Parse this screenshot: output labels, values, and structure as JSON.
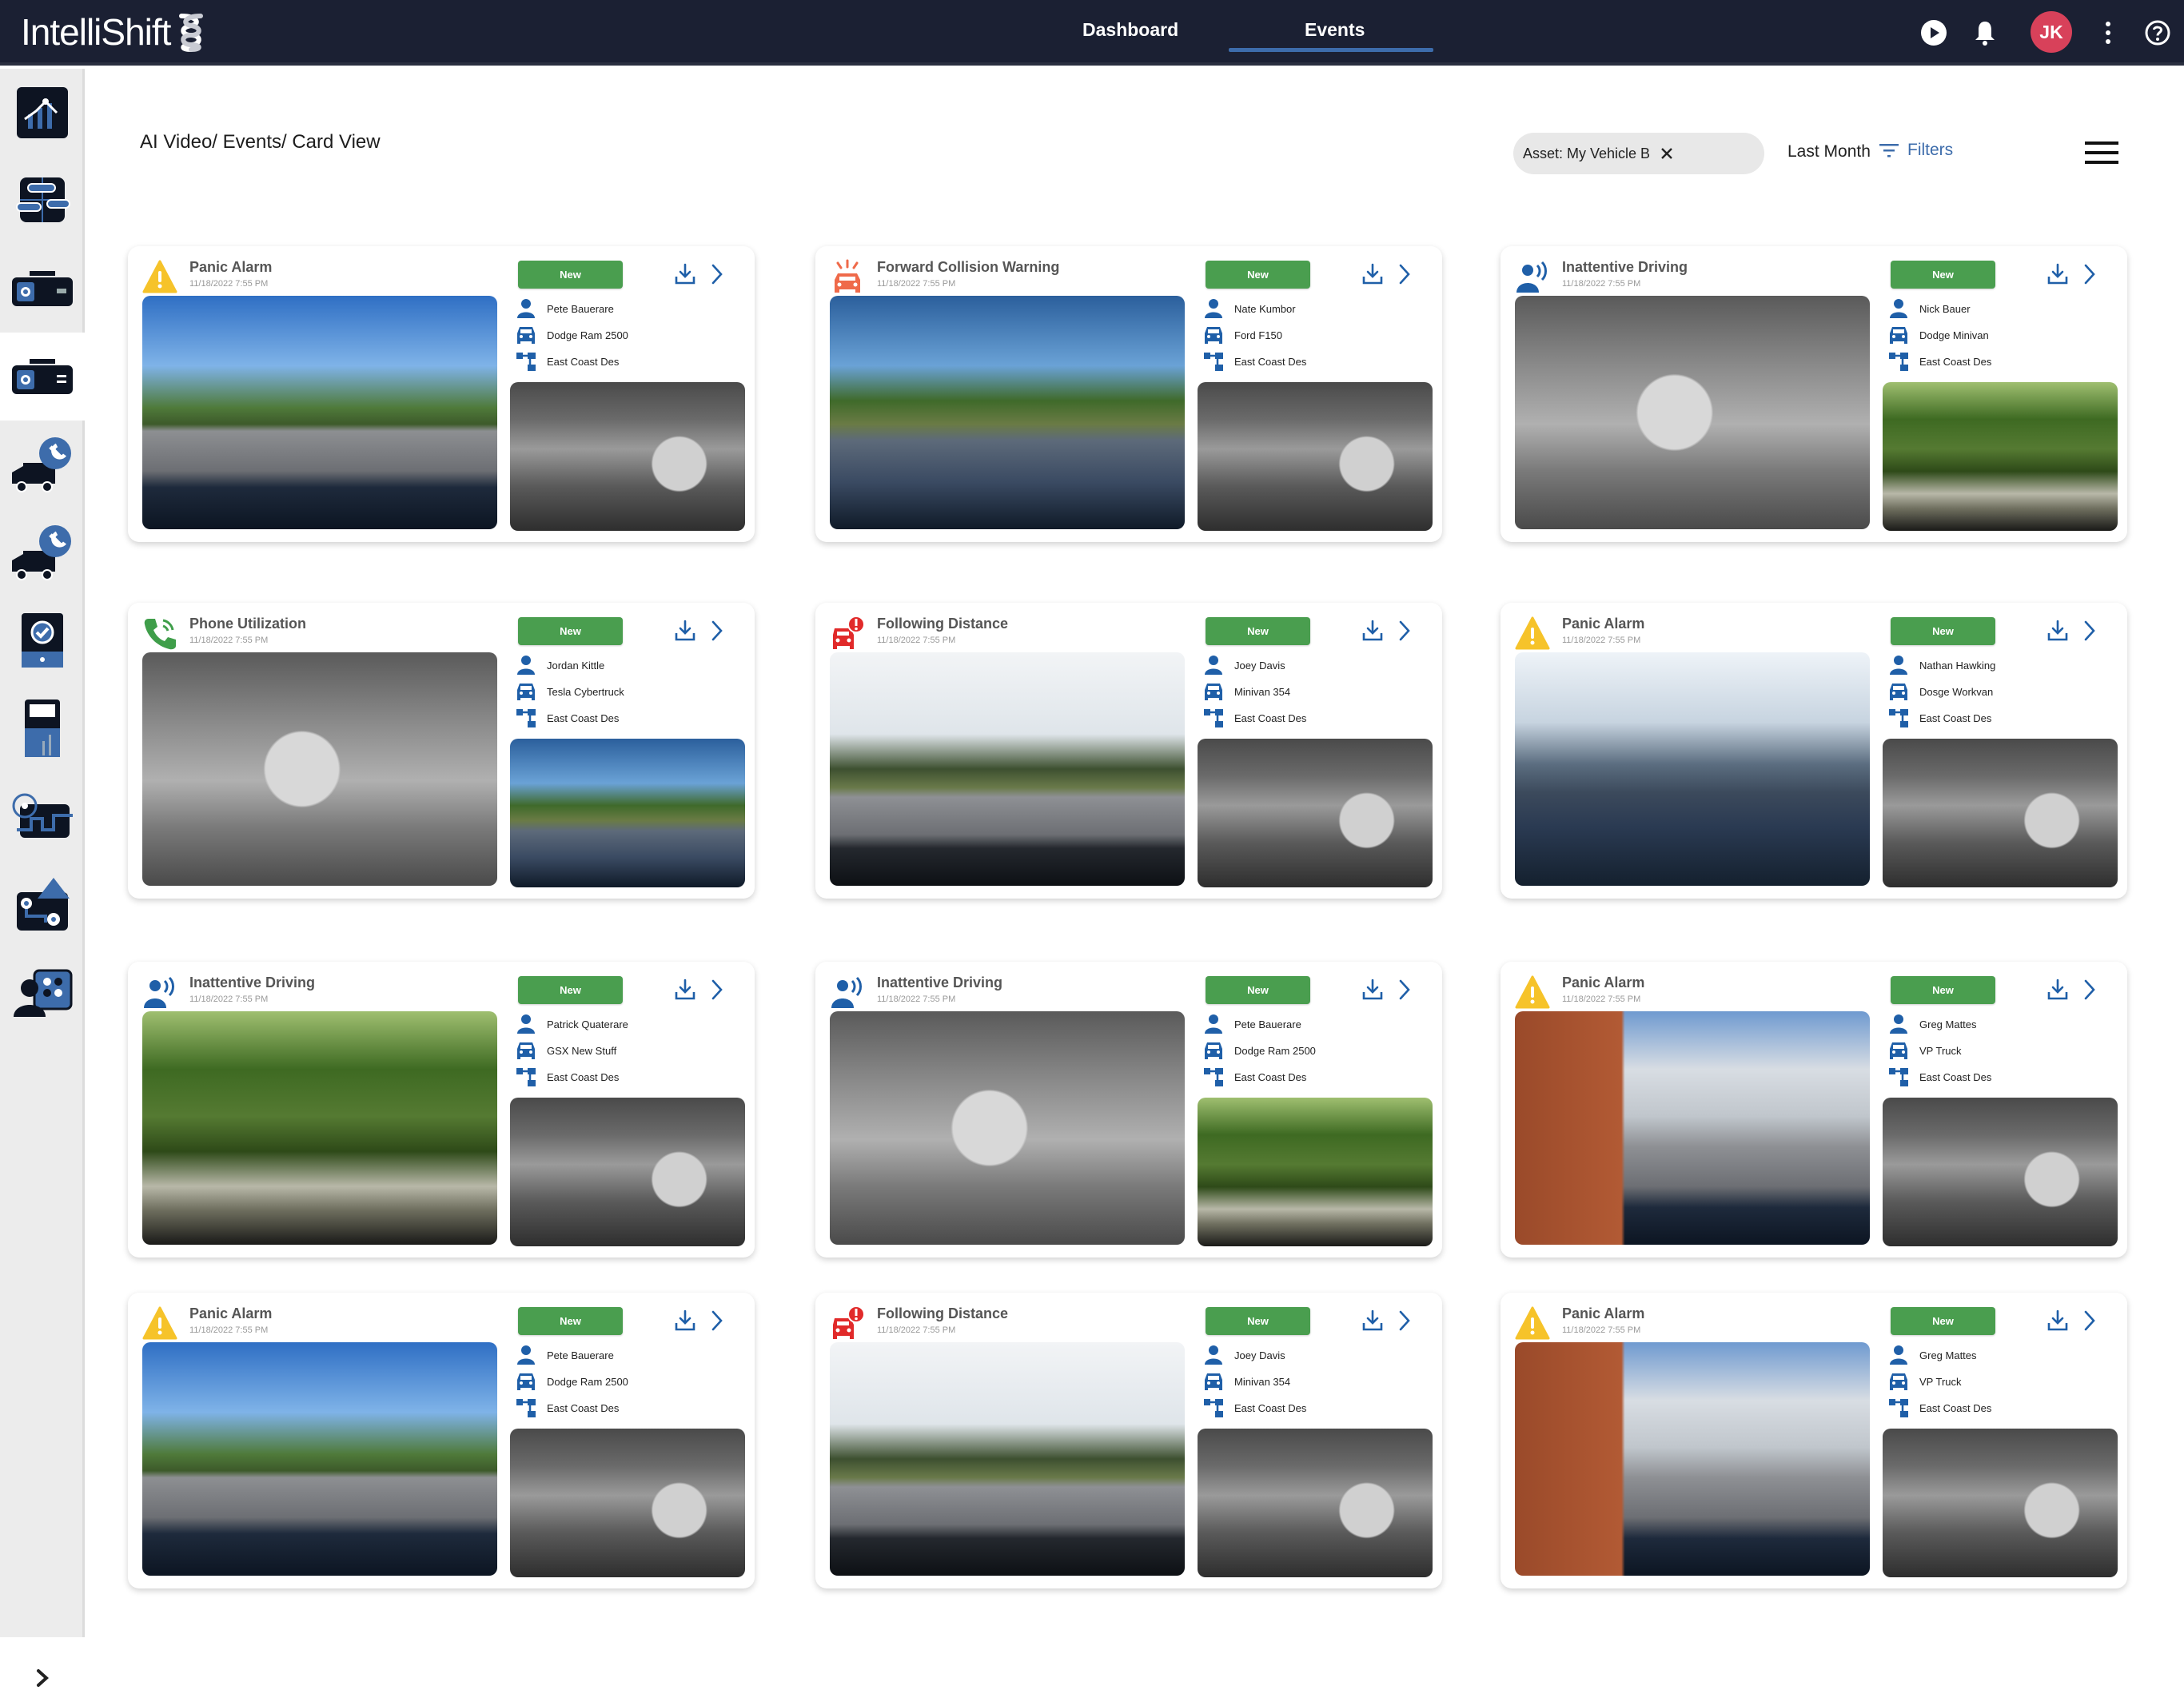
{
  "app": {
    "brand": "IntelliShift",
    "nav_tabs": [
      {
        "label": "Dashboard",
        "active": false
      },
      {
        "label": "Events",
        "active": true
      }
    ],
    "user_initials": "JK",
    "colors": {
      "header_bg": "#1b2033",
      "accent": "#3d6cab",
      "avatar": "#d8415a",
      "badge_new": "#4a9e4f",
      "icon_blue": "#1f5fa8",
      "warning_yellow": "#f6c32a",
      "collision_orange": "#ef6a4a",
      "distance_red": "#e12a2a",
      "phone_green": "#3f9e4a"
    }
  },
  "sidebar": {
    "items": [
      {
        "icon": "analytics-chart-icon",
        "active": false
      },
      {
        "icon": "dispatch-board-icon",
        "active": false
      },
      {
        "icon": "dashcam-icon",
        "active": false
      },
      {
        "icon": "dashcam-list-icon",
        "active": true
      },
      {
        "icon": "vehicle-maintenance-icon",
        "active": false
      },
      {
        "icon": "vehicle-service-icon",
        "active": false
      },
      {
        "icon": "inspection-tablet-icon",
        "active": false
      },
      {
        "icon": "fuel-reports-icon",
        "active": false
      },
      {
        "icon": "route-tracking-icon",
        "active": false
      },
      {
        "icon": "geofence-map-icon",
        "active": false
      },
      {
        "icon": "driver-management-icon",
        "active": false
      }
    ],
    "expand_icon": "chevron-right-icon"
  },
  "page": {
    "breadcrumb": "AI Video/ Events/ Card View",
    "filter_chip": "Asset: My Vehicle B",
    "period": "Last Month",
    "filters_label": "Filters"
  },
  "cards": [
    {
      "type": "panic",
      "title": "Panic Alarm",
      "time": "11/18/2022 7:55 PM",
      "status": "New",
      "driver": "Pete Bauerare",
      "vehicle": "Dodge Ram 2500",
      "group": "East Coast Des",
      "main": "scene-road",
      "side": "scene-cabin"
    },
    {
      "type": "collision",
      "title": "Forward Collision Warning",
      "time": "11/18/2022 7:55 PM",
      "status": "New",
      "driver": "Nate Kumbor",
      "vehicle": "Ford F150",
      "group": "East Coast Des",
      "main": "scene-road-green",
      "side": "scene-cabin"
    },
    {
      "type": "inattentive",
      "title": "Inattentive Driving",
      "time": "11/18/2022 7:55 PM",
      "status": "New",
      "driver": "Nick Bauer",
      "vehicle": "Dodge Minivan",
      "group": "East Coast Des",
      "main": "scene-cabin-light",
      "side": "scene-forest"
    },
    {
      "type": "phone",
      "title": "Phone Utilization",
      "time": "11/18/2022 7:55 PM",
      "status": "New",
      "driver": "Jordan Kittle",
      "vehicle": "Tesla Cybertruck",
      "group": "East Coast Des",
      "main": "scene-cabin-light",
      "side": "scene-road-green"
    },
    {
      "type": "distance",
      "title": "Following Distance",
      "time": "11/18/2022 7:55 PM",
      "status": "New",
      "driver": "Joey Davis",
      "vehicle": "Minivan 354",
      "group": "East Coast Des",
      "main": "scene-road-white",
      "side": "scene-cabin"
    },
    {
      "type": "panic",
      "title": "Panic Alarm",
      "time": "11/18/2022 7:55 PM",
      "status": "New",
      "driver": "Nathan Hawking",
      "vehicle": "Dosge Workvan",
      "group": "East Coast Des",
      "main": "scene-parking",
      "side": "scene-cabin"
    },
    {
      "type": "inattentive",
      "title": "Inattentive Driving",
      "time": "11/18/2022 7:55 PM",
      "status": "New",
      "driver": "Patrick Quaterare",
      "vehicle": "GSX New Stuff",
      "group": "East Coast Des",
      "main": "scene-forest",
      "side": "scene-cabin"
    },
    {
      "type": "inattentive",
      "title": "Inattentive Driving",
      "time": "11/18/2022 7:55 PM",
      "status": "New",
      "driver": "Pete Bauerare",
      "vehicle": "Dodge Ram 2500",
      "group": "East Coast Des",
      "main": "scene-cabin-light",
      "side": "scene-forest"
    },
    {
      "type": "panic",
      "title": "Panic Alarm",
      "time": "11/18/2022 7:55 PM",
      "status": "New",
      "driver": "Greg Mattes",
      "vehicle": "VP Truck",
      "group": "East Coast Des",
      "main": "scene-truck",
      "side": "scene-cabin"
    },
    {
      "type": "panic",
      "title": "Panic Alarm",
      "time": "11/18/2022 7:55 PM",
      "status": "New",
      "driver": "Pete Bauerare",
      "vehicle": "Dodge Ram 2500",
      "group": "East Coast Des",
      "main": "scene-road",
      "side": "scene-cabin"
    },
    {
      "type": "distance",
      "title": "Following Distance",
      "time": "11/18/2022 7:55 PM",
      "status": "New",
      "driver": "Joey Davis",
      "vehicle": "Minivan 354",
      "group": "East Coast Des",
      "main": "scene-road-white",
      "side": "scene-cabin"
    },
    {
      "type": "panic",
      "title": "Panic Alarm",
      "time": "11/18/2022 7:55 PM",
      "status": "New",
      "driver": "Greg Mattes",
      "vehicle": "VP Truck",
      "group": "East Coast Des",
      "main": "scene-truck",
      "side": "scene-cabin"
    }
  ]
}
